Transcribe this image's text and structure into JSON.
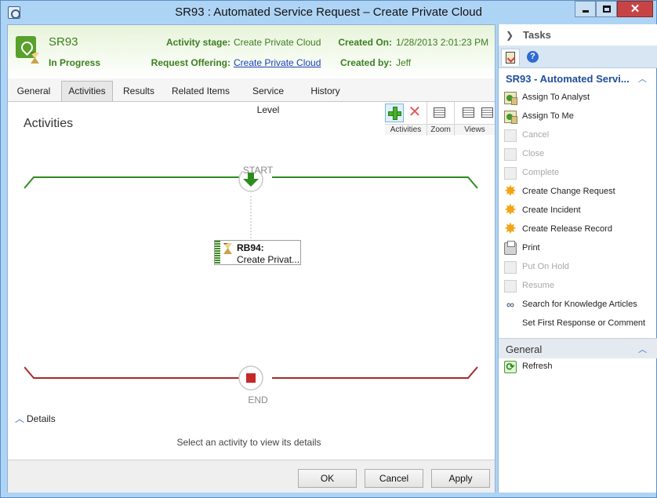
{
  "window": {
    "title": "SR93 : Automated Service Request – Create Private Cloud",
    "min_glyph": "",
    "max_glyph": "",
    "close_glyph": "✕"
  },
  "header": {
    "id": "SR93",
    "status": "In Progress",
    "activity_stage_label": "Activity stage:",
    "activity_stage_value": "Create Private Cloud",
    "request_offering_label": "Request Offering:",
    "request_offering_value": "Create Private Cloud",
    "created_on_label": "Created On:",
    "created_on_value": "1/28/2013 2:01:23 PM",
    "created_by_label": "Created by:",
    "created_by_value": "Jeff"
  },
  "tabs": [
    {
      "label": "General",
      "active": false
    },
    {
      "label": "Activities",
      "active": true
    },
    {
      "label": "Results",
      "active": false
    },
    {
      "label": "Related Items",
      "active": false
    },
    {
      "label": "Service Level",
      "active": false
    },
    {
      "label": "History",
      "active": false
    }
  ],
  "activities": {
    "title": "Activities",
    "toolbar": {
      "group_activities": "Activities",
      "group_zoom": "Zoom",
      "group_views": "Views"
    },
    "start_label": "START",
    "end_label": "END",
    "activity": {
      "id": "RB94:",
      "name": "Create Privat..."
    },
    "details_label": "Details",
    "details_hint": "Select an activity to view its details",
    "colors": {
      "start": "#2e8b1e",
      "end": "#a52a2a"
    }
  },
  "footer": {
    "ok": "OK",
    "cancel": "Cancel",
    "apply": "Apply"
  },
  "taskpane": {
    "title": "Tasks",
    "section_title": "SR93 - Automated Servi...",
    "tasks": [
      {
        "label": "Assign To Analyst",
        "icon": "assign-user-icon",
        "enabled": true
      },
      {
        "label": "Assign To Me",
        "icon": "assign-user-icon",
        "enabled": true
      },
      {
        "label": "Cancel",
        "icon": "cancel-icon",
        "enabled": false
      },
      {
        "label": "Close",
        "icon": "close-task-icon",
        "enabled": false
      },
      {
        "label": "Complete",
        "icon": "complete-icon",
        "enabled": false
      },
      {
        "label": "Create Change Request",
        "icon": "starburst-icon",
        "enabled": true
      },
      {
        "label": "Create Incident",
        "icon": "starburst-icon",
        "enabled": true
      },
      {
        "label": "Create Release Record",
        "icon": "starburst-icon",
        "enabled": true
      },
      {
        "label": "Print",
        "icon": "printer-icon",
        "enabled": true
      },
      {
        "label": "Put On Hold",
        "icon": "hold-icon",
        "enabled": false
      },
      {
        "label": "Resume",
        "icon": "resume-icon",
        "enabled": false
      },
      {
        "label": "Search for Knowledge Articles",
        "icon": "link-icon",
        "enabled": true
      },
      {
        "label": "Set First Response or Comment",
        "icon": "",
        "enabled": true
      }
    ],
    "general_title": "General",
    "refresh": "Refresh"
  }
}
